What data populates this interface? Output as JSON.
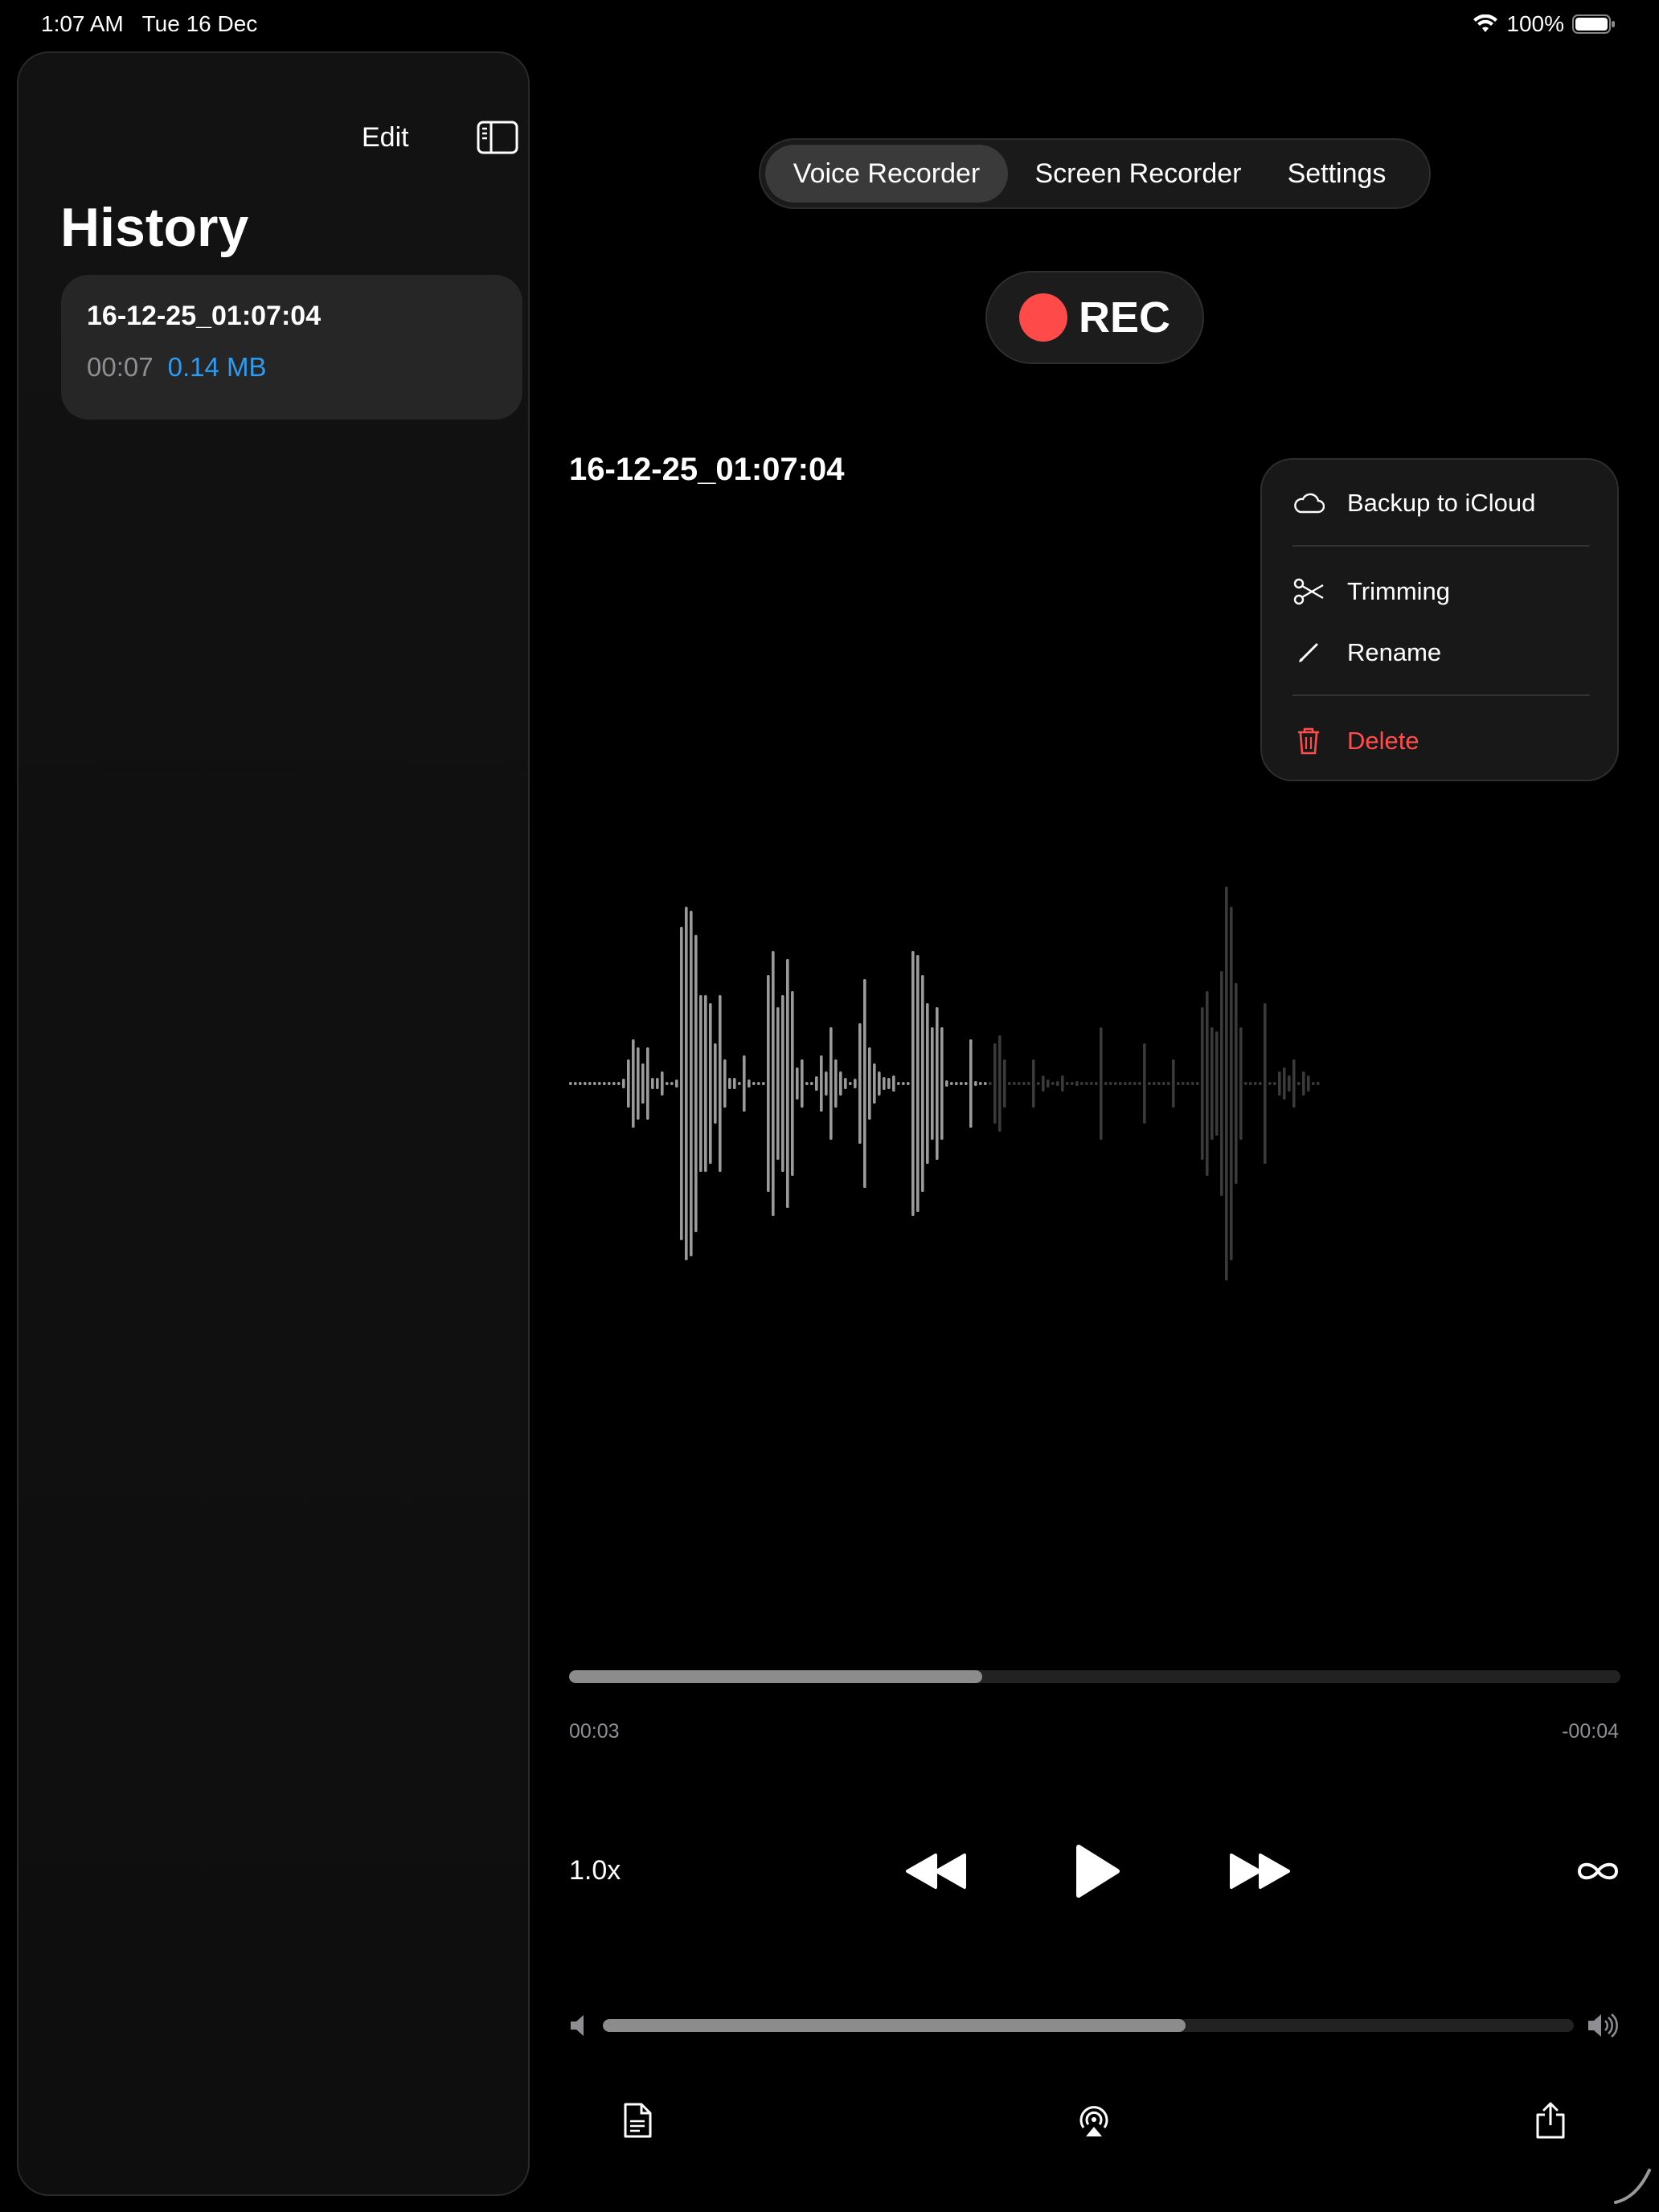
{
  "status": {
    "time": "1:07 AM",
    "date": "Tue 16 Dec",
    "battery": "100%",
    "icons": [
      "wifi-icon",
      "battery-icon"
    ]
  },
  "sidebar": {
    "edit_label": "Edit",
    "title": "History",
    "items": [
      {
        "name": "16-12-25_01:07:04",
        "duration": "00:07",
        "size": "0.14 MB"
      }
    ]
  },
  "tabs": [
    {
      "label": "Voice Recorder",
      "active": true
    },
    {
      "label": "Screen Recorder",
      "active": false
    },
    {
      "label": "Settings",
      "active": false
    }
  ],
  "rec": {
    "label": "REC"
  },
  "recording": {
    "title": "16-12-25_01:07:04"
  },
  "menu": {
    "items": [
      {
        "label": "Backup to iCloud",
        "icon": "cloud-icon"
      },
      {
        "label": "Trimming",
        "icon": "scissors-icon"
      },
      {
        "label": "Rename",
        "icon": "pencil-icon"
      },
      {
        "label": "Delete",
        "icon": "trash-icon"
      }
    ]
  },
  "playback": {
    "elapsed": "00:03",
    "remaining": "-00:04",
    "progress_fraction": 0.393,
    "speed": "1.0x",
    "volume_fraction": 0.6
  },
  "colors": {
    "accent_blue": "#2e9bf0",
    "rec_red": "#ff4a4a",
    "delete_red": "#ff4d4d"
  }
}
